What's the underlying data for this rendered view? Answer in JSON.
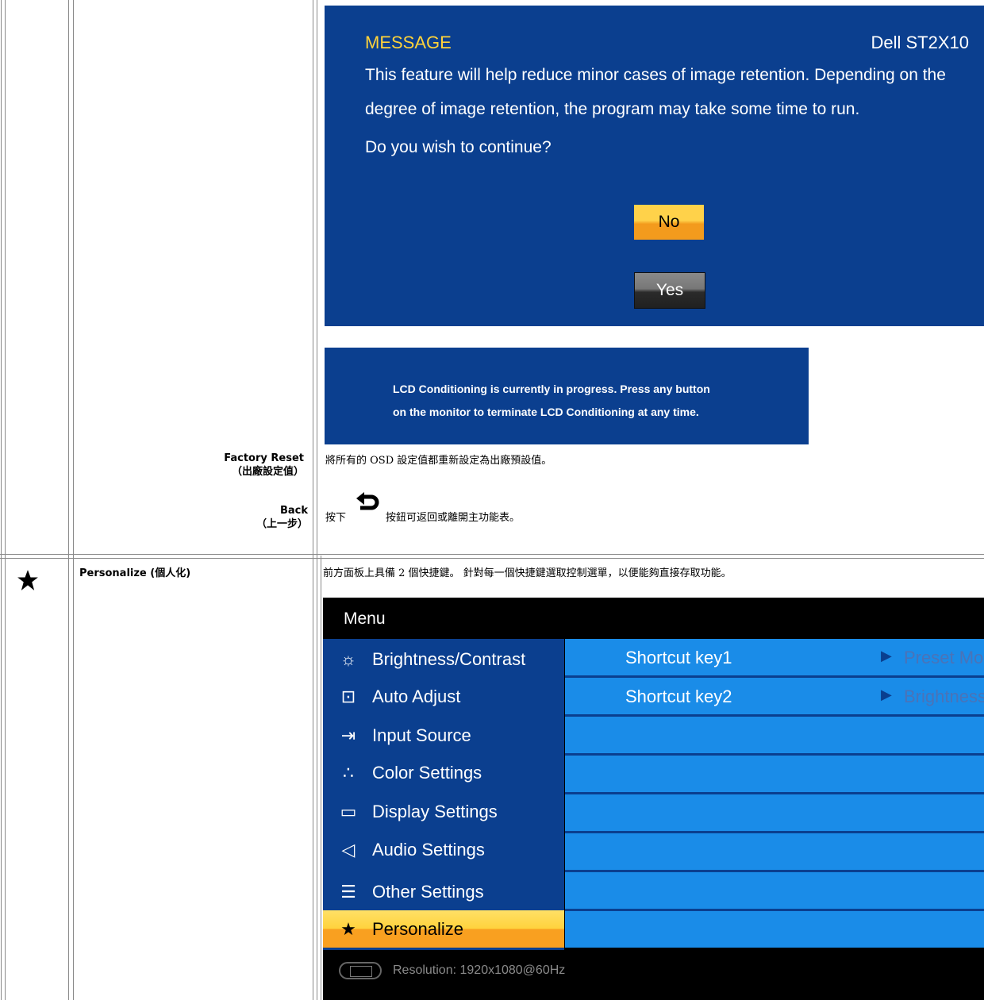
{
  "factory_reset": {
    "label_en": "Factory Reset",
    "label_zh": "（出廠設定值）",
    "desc": "將所有的 OSD 設定值都重新設定為出廠預設值。"
  },
  "back": {
    "label_en": "Back",
    "label_zh": "（上一步）",
    "desc_before": "按下",
    "desc_after": "按鈕可返回或離開主功能表。",
    "icon": "back-arrow-icon"
  },
  "personalize": {
    "label": "Personalize (個人化)",
    "desc": "前方面板上具備 2 個快捷鍵。 針對每一個快捷鍵選取控制選單，以便能夠直接存取功能。",
    "icon": "star-icon"
  },
  "message_dialog": {
    "title": "MESSAGE",
    "model": "Dell ST2X10",
    "line1": "This feature will help reduce minor cases of image retention. Depending on the",
    "line2": "degree of image retention, the program may take some time to run.",
    "question": "Do you wish to continue?",
    "no_label": "No",
    "yes_label": "Yes",
    "colors": {
      "background": "#0b3f8f",
      "title": "#ffd33a"
    }
  },
  "progress_dialog": {
    "line1": "LCD Conditioning is currently in progress. Press any button",
    "line2": "on the monitor to terminate LCD Conditioning at any time."
  },
  "osd_menu": {
    "title": "Menu",
    "items": [
      {
        "label": "Brightness/Contrast",
        "icon": "sun-icon"
      },
      {
        "label": "Auto Adjust",
        "icon": "auto-adjust-icon"
      },
      {
        "label": "Input Source",
        "icon": "input-source-icon"
      },
      {
        "label": "Color Settings",
        "icon": "color-dots-icon"
      },
      {
        "label": "Display Settings",
        "icon": "display-rect-icon"
      },
      {
        "label": "Audio Settings",
        "icon": "speaker-icon"
      },
      {
        "label": "Other Settings",
        "icon": "sliders-icon"
      },
      {
        "label": "Personalize",
        "icon": "star-icon",
        "selected": true
      }
    ],
    "shortcuts": [
      {
        "label": "Shortcut key1",
        "value": "Preset Mo"
      },
      {
        "label": "Shortcut key2",
        "value": "Brightness"
      }
    ],
    "resolution": "Resolution:  1920x1080@60Hz",
    "colors": {
      "left_panel": "#0b3f8f",
      "right_panel": "#1a8ce8",
      "selected": "#f9a020",
      "shortcut_value": "#4a73b8"
    }
  }
}
